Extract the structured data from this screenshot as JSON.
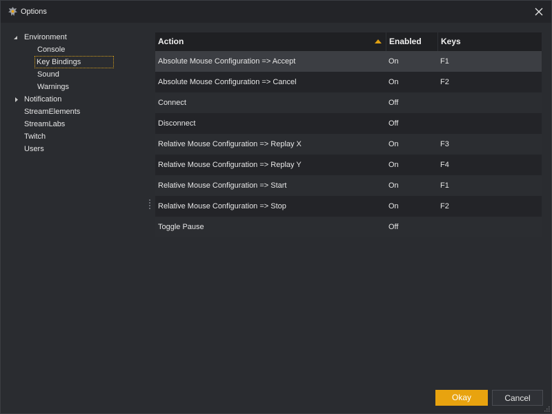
{
  "window": {
    "title": "Options",
    "app_icon": "dragon-logo-icon",
    "close_icon": "close-icon"
  },
  "tree": {
    "items": [
      {
        "label": "Environment",
        "level": 0,
        "state": "expanded"
      },
      {
        "label": "Console",
        "level": 1
      },
      {
        "label": "Key Bindings",
        "level": 1,
        "selected": true
      },
      {
        "label": "Sound",
        "level": 1
      },
      {
        "label": "Warnings",
        "level": 1
      },
      {
        "label": "Notification",
        "level": 0,
        "state": "collapsed"
      },
      {
        "label": "StreamElements",
        "level": 0
      },
      {
        "label": "StreamLabs",
        "level": 0
      },
      {
        "label": "Twitch",
        "level": 0
      },
      {
        "label": "Users",
        "level": 0
      }
    ]
  },
  "grid": {
    "columns": {
      "action": "Action",
      "enabled": "Enabled",
      "keys": "Keys"
    },
    "sort_column": "action",
    "sort_direction": "ascending",
    "rows": [
      {
        "action": "Absolute Mouse Configuration => Accept",
        "enabled": "On",
        "keys": "F1"
      },
      {
        "action": "Absolute Mouse Configuration => Cancel",
        "enabled": "On",
        "keys": "F2"
      },
      {
        "action": "Connect",
        "enabled": "Off",
        "keys": ""
      },
      {
        "action": "Disconnect",
        "enabled": "Off",
        "keys": ""
      },
      {
        "action": "Relative Mouse Configuration => Replay X",
        "enabled": "On",
        "keys": "F3"
      },
      {
        "action": "Relative Mouse Configuration => Replay Y",
        "enabled": "On",
        "keys": "F4"
      },
      {
        "action": "Relative Mouse Configuration => Start",
        "enabled": "On",
        "keys": "F1"
      },
      {
        "action": "Relative Mouse Configuration => Stop",
        "enabled": "On",
        "keys": "F2"
      },
      {
        "action": "Toggle Pause",
        "enabled": "Off",
        "keys": ""
      }
    ],
    "selected_row": 0
  },
  "buttons": {
    "okay": "Okay",
    "cancel": "Cancel"
  },
  "colors": {
    "accent": "#e8a30f",
    "background": "#2a2c30",
    "titlebar": "#232428",
    "header": "#1f2023",
    "row_odd": "#2b2d31",
    "row_even": "#232428",
    "row_selected": "#3c3e43"
  }
}
